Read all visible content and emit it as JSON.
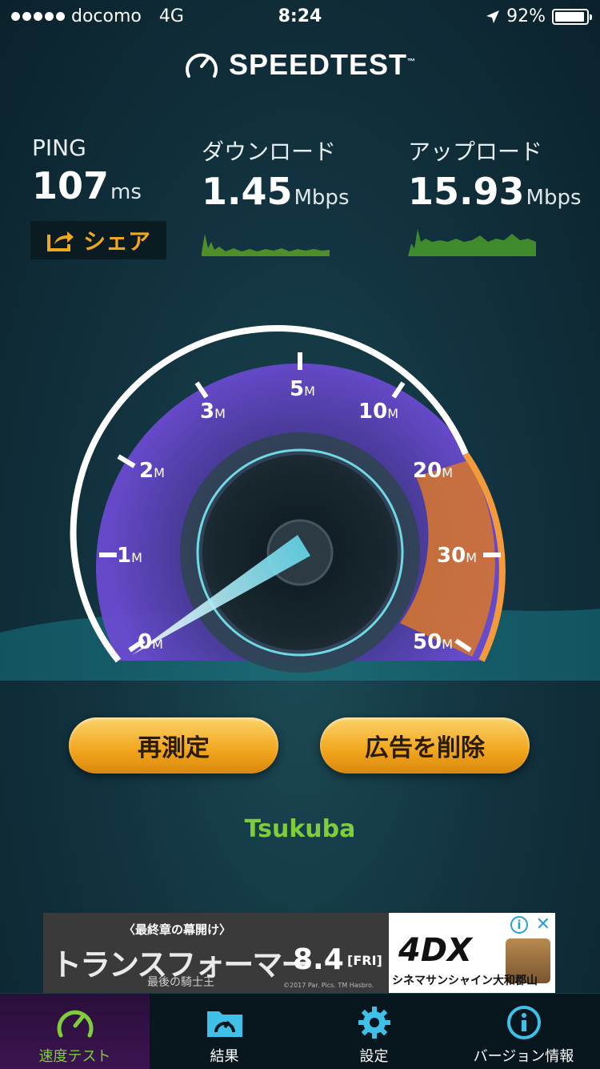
{
  "status_bar": {
    "carrier": "docomo",
    "network": "4G",
    "time": "8:24",
    "battery": "92%"
  },
  "header": {
    "logo_text": "SPEEDTEST",
    "trademark": "™"
  },
  "results": {
    "ping": {
      "label": "PING",
      "value": "107",
      "unit": "ms"
    },
    "download": {
      "label": "ダウンロード",
      "value": "1.45",
      "unit": "Mbps"
    },
    "upload": {
      "label": "アップロード",
      "value": "15.93",
      "unit": "Mbps"
    },
    "share_label": "シェア"
  },
  "gauge": {
    "ticks": [
      {
        "num": "0",
        "unit": "M"
      },
      {
        "num": "1",
        "unit": "M"
      },
      {
        "num": "2",
        "unit": "M"
      },
      {
        "num": "3",
        "unit": "M"
      },
      {
        "num": "5",
        "unit": "M"
      },
      {
        "num": "10",
        "unit": "M"
      },
      {
        "num": "20",
        "unit": "M"
      },
      {
        "num": "30",
        "unit": "M"
      },
      {
        "num": "50",
        "unit": "M"
      }
    ],
    "colors": {
      "purple": "#5b3aa8",
      "orange": "#e57e26",
      "cyan": "#3fd6e8"
    }
  },
  "buttons": {
    "retest": "再測定",
    "remove_ads": "広告を削除"
  },
  "server": "Tsukuba",
  "ad": {
    "kicker": "〈最終章の幕開け〉",
    "title": "トランスフォーマー",
    "subtitle": "最後の騎士王",
    "date": "8.4",
    "day": "[FRI]",
    "copyright": "©2017 Par. Pics. TM Hasbro.",
    "brand": "4DX",
    "cinema": "シネマサンシャイン大和郡山"
  },
  "tabs": [
    {
      "label": "速度テスト",
      "icon": "speedometer-icon",
      "active": true
    },
    {
      "label": "結果",
      "icon": "folder-gauge-icon",
      "active": false
    },
    {
      "label": "設定",
      "icon": "gear-icon",
      "active": false
    },
    {
      "label": "バージョン情報",
      "icon": "info-icon",
      "active": false
    }
  ]
}
